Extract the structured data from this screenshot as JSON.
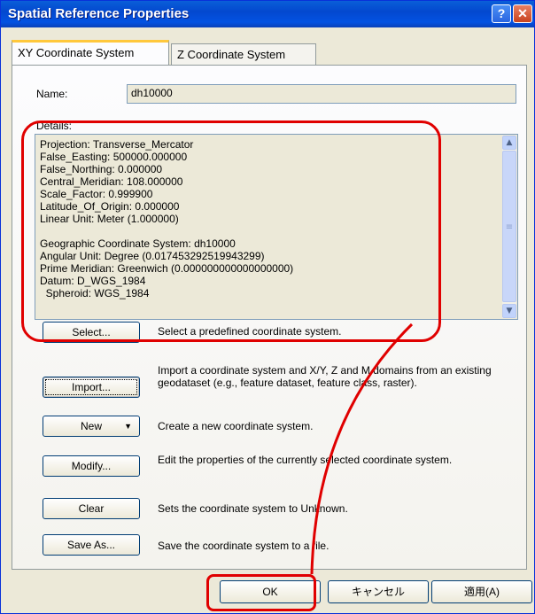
{
  "window": {
    "title": "Spatial Reference Properties",
    "help_glyph": "?",
    "close_glyph": "✕"
  },
  "tabs": [
    {
      "label": "XY Coordinate System",
      "active": true
    },
    {
      "label": "Z Coordinate System",
      "active": false
    }
  ],
  "fields": {
    "name_label": "Name:",
    "name_value": "dh10000",
    "details_label": "Details:"
  },
  "details_text": "Projection: Transverse_Mercator\nFalse_Easting: 500000.000000\nFalse_Northing: 0.000000\nCentral_Meridian: 108.000000\nScale_Factor: 0.999900\nLatitude_Of_Origin: 0.000000\nLinear Unit: Meter (1.000000)\n\nGeographic Coordinate System: dh10000\nAngular Unit: Degree (0.017453292519943299)\nPrime Meridian: Greenwich (0.000000000000000000)\nDatum: D_WGS_1984\n  Spheroid: WGS_1984",
  "actions": [
    {
      "label": "Select...",
      "description": "Select a predefined coordinate system."
    },
    {
      "label": "Import...",
      "description": "Import a coordinate system and X/Y, Z and M domains from an existing geodataset (e.g., feature dataset, feature class, raster)."
    },
    {
      "label": "New",
      "description": "Create a new coordinate system.",
      "dropdown_glyph": "▼"
    },
    {
      "label": "Modify...",
      "description": "Edit the properties of the currently selected coordinate system."
    },
    {
      "label": "Clear",
      "description": "Sets the coordinate system to Unknown."
    },
    {
      "label": "Save As...",
      "description": "Save the coordinate system to a file."
    }
  ],
  "footer": {
    "ok_label": "OK",
    "cancel_label": "キャンセル",
    "apply_label": "適用(A)"
  },
  "icons": {
    "scroll_up": "▲",
    "scroll_down": "▼",
    "scroll_grip": "≡"
  },
  "colors": {
    "titlebar": "#0348cf",
    "annotation": "#e00000",
    "dialog_bg": "#ece9d8"
  }
}
